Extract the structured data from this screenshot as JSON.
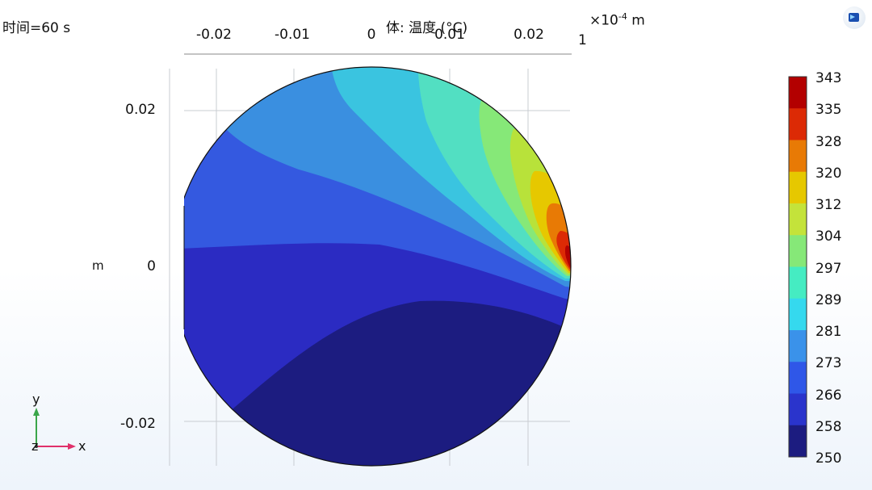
{
  "time_label": "时间=60 s",
  "plot_title": "体: 温度 (°C)",
  "x_axis": {
    "scale_base": "×10",
    "scale_exponent": "-4",
    "unit": "m",
    "scale_number": "1",
    "ticks": [
      "-0.02",
      "-0.01",
      "0",
      "0.01",
      "0.02"
    ],
    "tick_values": [
      -0.02,
      -0.01,
      0,
      0.01,
      0.02
    ]
  },
  "y_axis": {
    "unit": "m",
    "ticks": [
      "0.02",
      "0",
      "-0.02"
    ],
    "tick_values": [
      0.02,
      0,
      -0.02
    ]
  },
  "colorbar": {
    "labels": [
      "343",
      "335",
      "328",
      "320",
      "312",
      "304",
      "297",
      "289",
      "281",
      "273",
      "266",
      "258",
      "250"
    ],
    "colors_top_to_bottom": [
      "#b30000",
      "#dc2a05",
      "#e87a05",
      "#e6c800",
      "#c4e33a",
      "#86e878",
      "#45ecc2",
      "#35d9ee",
      "#3a92ea",
      "#2f57e8",
      "#2a34cc",
      "#1c1c80"
    ]
  },
  "contour_colors": {
    "c250": "#1c1c80",
    "c258": "#2b2bc2",
    "c266": "#3459e0",
    "c273": "#3a8fe0",
    "c281": "#3ac4e0",
    "c289": "#52dfc2",
    "c297": "#86e878",
    "c304": "#b8e23a",
    "c312": "#e6c800",
    "c320": "#e87a05",
    "c328": "#dc2a05",
    "c335": "#b30000"
  },
  "triad": {
    "x": "x",
    "y": "y",
    "z": "z"
  },
  "colors": {
    "x_axis_arrow": "#e0306a",
    "y_axis_arrow": "#3aa64a"
  }
}
